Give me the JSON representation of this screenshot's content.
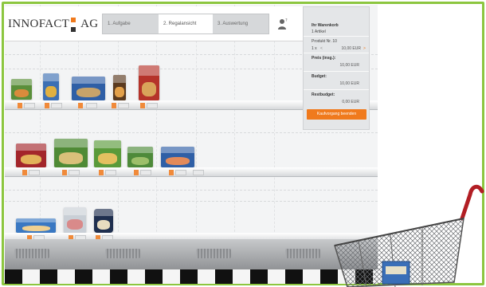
{
  "header": {
    "logo_left": "INNOFACT",
    "logo_right": "AG",
    "steps": [
      {
        "label": "1. Aufgabe",
        "active": false
      },
      {
        "label": "2. Regalansicht",
        "active": true
      },
      {
        "label": "3. Auswertung",
        "active": false
      }
    ],
    "icons": {
      "user": "user-question-icon"
    }
  },
  "cart": {
    "title": "Ihr Warenkorb",
    "count": "1 Artikel",
    "product_nav": "Produkt Nr. 10",
    "product_line": "1 x",
    "product_price": "10,00 EUR",
    "price_label": "Preis (insg.):",
    "price_value": "10,00 EUR",
    "budget_label": "Budget:",
    "budget_value": "10,00 EUR",
    "rest_label": "Restbudget:",
    "rest_value": "0,00 EUR",
    "checkout_label": "Kaufvorgang beenden"
  },
  "colors": {
    "frame": "#8cc63f",
    "accent": "#f07a1d",
    "shelf": "#f3f4f5"
  }
}
